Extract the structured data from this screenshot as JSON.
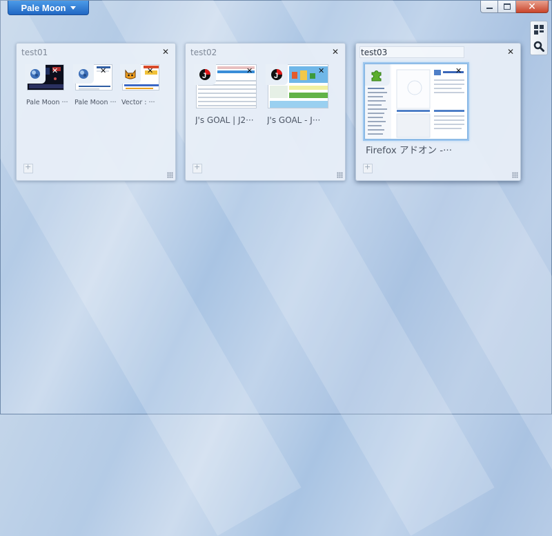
{
  "app": {
    "menu_label": "Pale Moon"
  },
  "window_controls": {
    "minimize": "minimize",
    "maximize": "maximize",
    "close": "close"
  },
  "toolbar": {
    "groups_icon": "tab-groups-icon",
    "search_icon": "search-icon"
  },
  "groups": [
    {
      "title": "test01",
      "tabs": [
        {
          "label": "Pale Moon ···"
        },
        {
          "label": "Pale Moon ···"
        },
        {
          "label": "Vector : ···"
        }
      ]
    },
    {
      "title": "test02",
      "tabs": [
        {
          "label": "J's GOAL | J2···"
        },
        {
          "label": "J's GOAL -  J···"
        }
      ]
    },
    {
      "title": "test03",
      "tabs": [
        {
          "label": "Firefox アドオン -···"
        }
      ]
    }
  ],
  "colors": {
    "accent": "#2167c3",
    "close_red": "#c9452b",
    "group_bg": "#e8eff7"
  }
}
